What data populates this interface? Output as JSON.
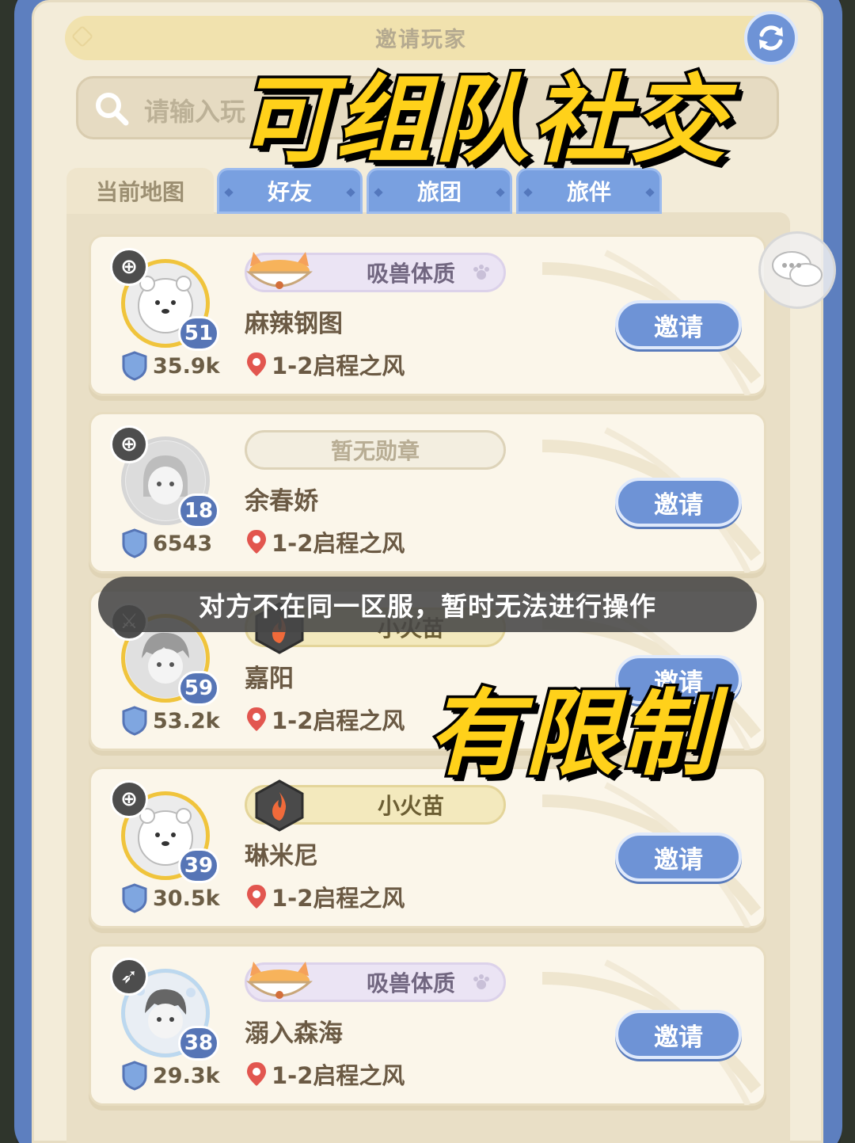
{
  "header": {
    "title": "邀请玩家"
  },
  "search": {
    "placeholder": "请输入玩"
  },
  "overlay": {
    "headline": "可组队社交",
    "limit_label": "有限制"
  },
  "tabs": [
    {
      "label": "当前地图",
      "active": true
    },
    {
      "label": "好友",
      "active": false
    },
    {
      "label": "旅团",
      "active": false
    },
    {
      "label": "旅伴",
      "active": false
    }
  ],
  "players": [
    {
      "medal": "吸兽体质",
      "medal_icon": "food-bowl-icon",
      "name": "麻辣钢图",
      "level": "51",
      "power": "35.9k",
      "location": "1-2启程之风",
      "invite_label": "邀请",
      "class_icon": "crosshair-icon",
      "avatar": "white-bear-avatar"
    },
    {
      "medal": "暂无勋章",
      "medal_icon": "",
      "name": "余春娇",
      "level": "18",
      "power": "6543",
      "location": "1-2启程之风",
      "invite_label": "邀请",
      "class_icon": "crosshair-icon",
      "avatar": "girl-avatar"
    },
    {
      "medal": "小火苗",
      "medal_icon": "flame-icon",
      "name": "嘉阳",
      "level": "59",
      "power": "53.2k",
      "location": "1-2启程之风",
      "invite_label": "邀请",
      "class_icon": "sword-icon",
      "avatar": "boy-avatar"
    },
    {
      "medal": "小火苗",
      "medal_icon": "flame-icon",
      "name": "琳米尼",
      "level": "39",
      "power": "30.5k",
      "location": "1-2启程之风",
      "invite_label": "邀请",
      "class_icon": "crosshair-icon",
      "avatar": "white-bear-avatar"
    },
    {
      "medal": "吸兽体质",
      "medal_icon": "food-bowl-icon",
      "name": "溺入森海",
      "level": "38",
      "power": "29.3k",
      "location": "1-2启程之风",
      "invite_label": "邀请",
      "class_icon": "bow-icon",
      "avatar": "floral-boy-avatar"
    }
  ],
  "toast": {
    "message": "对方不在同一区服，暂时无法进行操作"
  },
  "colors": {
    "accent_blue": "#6e93d6",
    "panel_bg": "#f3ecd9",
    "headline_yellow": "#ffd11a"
  }
}
